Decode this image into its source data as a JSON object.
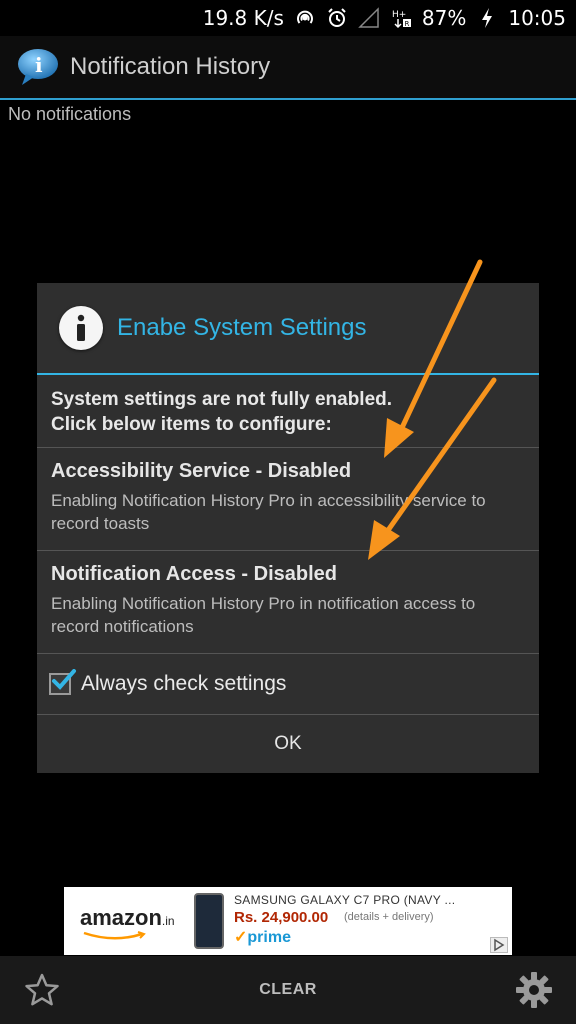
{
  "status_bar": {
    "speed": "19.8 K/s",
    "battery": "87%",
    "time": "10:05",
    "icons": [
      "hotspot-icon",
      "alarm-icon",
      "signal-icon",
      "data-icon",
      "charging-icon"
    ]
  },
  "app_bar": {
    "title": "Notification History",
    "accent_color": "#33b5e5"
  },
  "content": {
    "empty_text": "No notifications"
  },
  "dialog": {
    "title": "Enabe System Settings",
    "message_line1": "System settings are not fully enabled.",
    "message_line2": "Click below items to configure:",
    "items": [
      {
        "title": "Accessibility Service - Disabled",
        "description": "Enabling Notification History Pro in accessibility service to record toasts"
      },
      {
        "title": "Notification Access - Disabled",
        "description": "Enabling Notification History Pro in notification access to record notifications"
      }
    ],
    "checkbox_label": "Always check settings",
    "checkbox_checked": true,
    "ok_label": "OK"
  },
  "ad": {
    "brand": "amazon",
    "brand_suffix": ".in",
    "product": "SAMSUNG GALAXY C7 PRO (NAVY ...",
    "price": "Rs. 24,900.00",
    "delivery": "(details + delivery)",
    "prime": "prime"
  },
  "bottom_bar": {
    "clear_label": "CLEAR"
  },
  "annotation_color": "#f7941d"
}
